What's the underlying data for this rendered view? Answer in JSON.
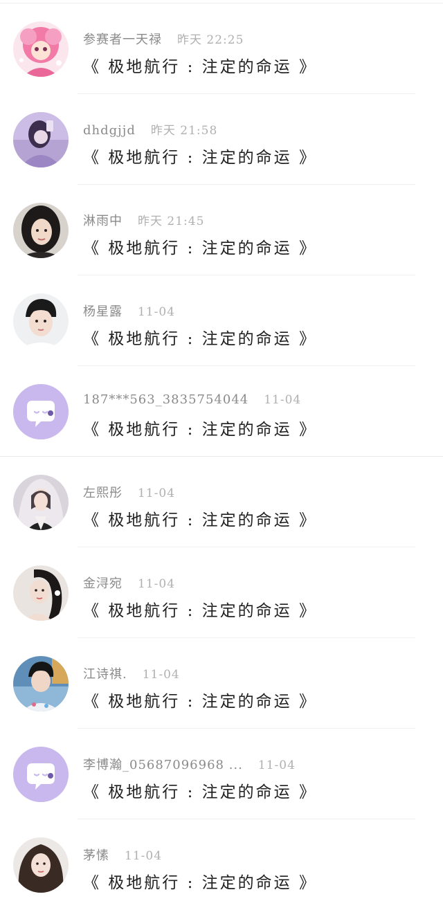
{
  "messages": [
    {
      "name": "参赛者一天禄",
      "time": "昨天 22:25",
      "text": "《 极地航行 : 注定的命运 》",
      "avatar": "photo-avatar-pink-anime"
    },
    {
      "name": "dhdgjjd",
      "time": "昨天 21:58",
      "text": "《 极地航行 : 注定的命运 》",
      "avatar": "photo-avatar-purple"
    },
    {
      "name": "淋雨中",
      "time": "昨天 21:45",
      "text": "《 极地航行 : 注定的命运 》",
      "avatar": "photo-avatar-girl-dark-hair"
    },
    {
      "name": "杨星露",
      "time": "11-04",
      "text": "《 极地航行 : 注定的命运 》",
      "avatar": "photo-avatar-boy"
    },
    {
      "name": "187***563_3835754044",
      "time": "11-04",
      "text": "《 极地航行 : 注定的命运 》",
      "avatar": "default-chat-bubble-icon"
    },
    {
      "name": "左熙彤",
      "time": "11-04",
      "text": "《 极地航行 : 注定的命运 》",
      "avatar": "photo-avatar-girl-veil"
    },
    {
      "name": "金浔宛",
      "time": "11-04",
      "text": "《 极地航行 : 注定的命运 》",
      "avatar": "photo-avatar-girl-portrait"
    },
    {
      "name": "江诗祺.",
      "time": "11-04",
      "text": "《 极地航行 : 注定的命运 》",
      "avatar": "photo-avatar-boy-outdoor"
    },
    {
      "name": "李博瀚_05687096968 ...",
      "time": "11-04",
      "text": "《 极地航行 : 注定的命运 》",
      "avatar": "default-chat-bubble-icon"
    },
    {
      "name": "茅愫",
      "time": "11-04",
      "text": "《 极地航行 : 注定的命运 》",
      "avatar": "photo-avatar-girl-curly"
    }
  ],
  "colors": {
    "default_avatar_bg": "#c9b8ee",
    "name_text": "#8a8a8a",
    "time_text": "#b0b0b0",
    "message_text": "#1f1f1f"
  }
}
